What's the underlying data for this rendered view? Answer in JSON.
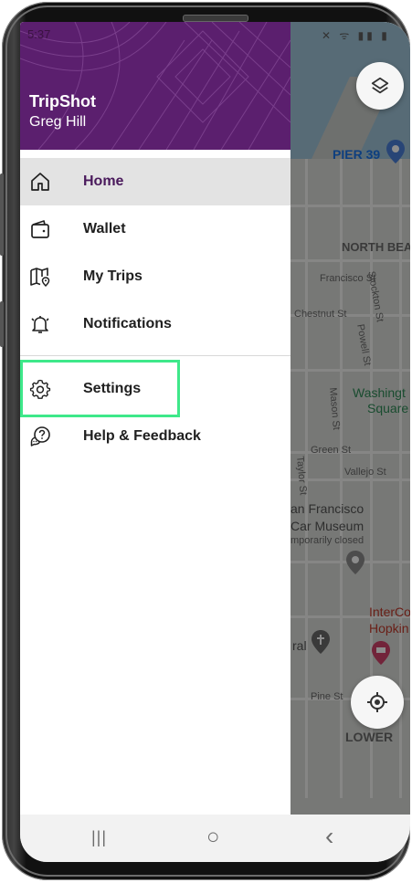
{
  "status_bar": {
    "time": "5:37"
  },
  "drawer": {
    "app_name": "TripShot",
    "user_name": "Greg Hill",
    "items": [
      {
        "label": "Home",
        "icon": "home-icon",
        "active": true
      },
      {
        "label": "Wallet",
        "icon": "wallet-icon",
        "active": false
      },
      {
        "label": "My Trips",
        "icon": "map-pin-icon",
        "active": false
      },
      {
        "label": "Notifications",
        "icon": "bell-icon",
        "active": false
      },
      {
        "label": "Settings",
        "icon": "gear-icon",
        "active": false
      },
      {
        "label": "Help & Feedback",
        "icon": "help-chat-icon",
        "active": false
      }
    ]
  },
  "map": {
    "labels": {
      "pier": "PIER 39",
      "north_beach": "NORTH BEAC",
      "francisco_st": "Francisco St",
      "stockton_st": "Stockton St",
      "chestnut_st": "Chestnut St",
      "powell_st": "Powell St",
      "mason_st": "Mason St",
      "washington_sq_1": "Washingt",
      "washington_sq_2": "Square",
      "green_st": "Green St",
      "taylor_st": "Taylor St",
      "vallejo_st": "Vallejo St",
      "museum_1": "an Francisco",
      "museum_2": "Car Museum",
      "museum_3": "mporarily closed",
      "intercontinental_1": "InterCo",
      "intercontinental_2": "Hopkin",
      "cathedral": "ral",
      "pine_st": "Pine St",
      "lower": "LOWER"
    }
  },
  "colors": {
    "header_purple": "#5b1f6e",
    "active_label": "#4a1a5c",
    "highlight_green": "#3ee88a"
  },
  "navbar": {
    "recents": "|||",
    "home": "○",
    "back": "‹"
  }
}
